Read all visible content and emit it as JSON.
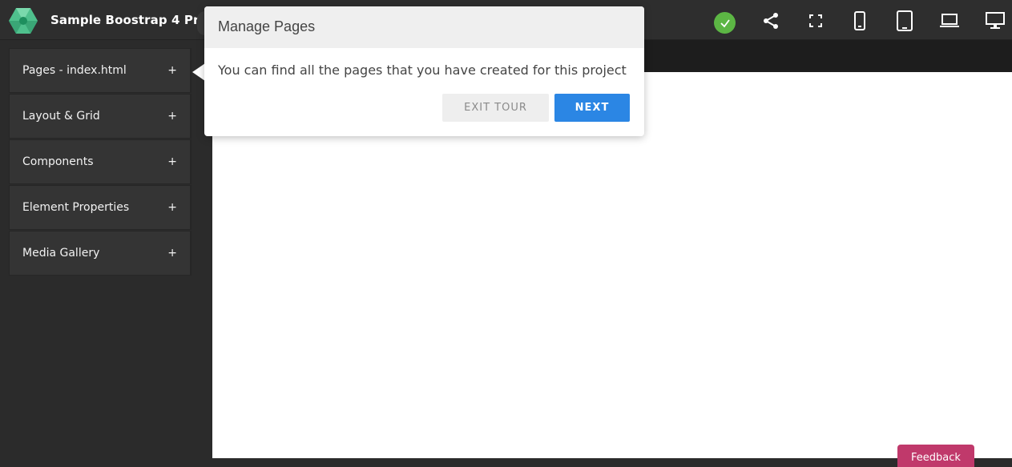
{
  "header": {
    "project_title": "Sample Boostrap 4 Pr...",
    "icons": [
      "logo-icon",
      "check-circle-icon",
      "share-icon",
      "fullscreen-icon",
      "phone-icon",
      "tablet-icon",
      "laptop-icon",
      "desktop-icon"
    ],
    "status_color": "#5cb644"
  },
  "sidebar": {
    "items": [
      {
        "label": "Pages - index.html",
        "toggle": "+"
      },
      {
        "label": "Layout & Grid",
        "toggle": "+"
      },
      {
        "label": "Components",
        "toggle": "+"
      },
      {
        "label": "Element Properties",
        "toggle": "+"
      },
      {
        "label": "Media Gallery",
        "toggle": "+"
      }
    ]
  },
  "tour": {
    "title": "Manage Pages",
    "message": "You can find all the pages that you have created for this project",
    "exit_label": "EXIT TOUR",
    "next_label": "NEXT",
    "accent_color": "#2b86e4"
  },
  "feedback": {
    "label": "Feedback",
    "color": "#c0396b"
  }
}
